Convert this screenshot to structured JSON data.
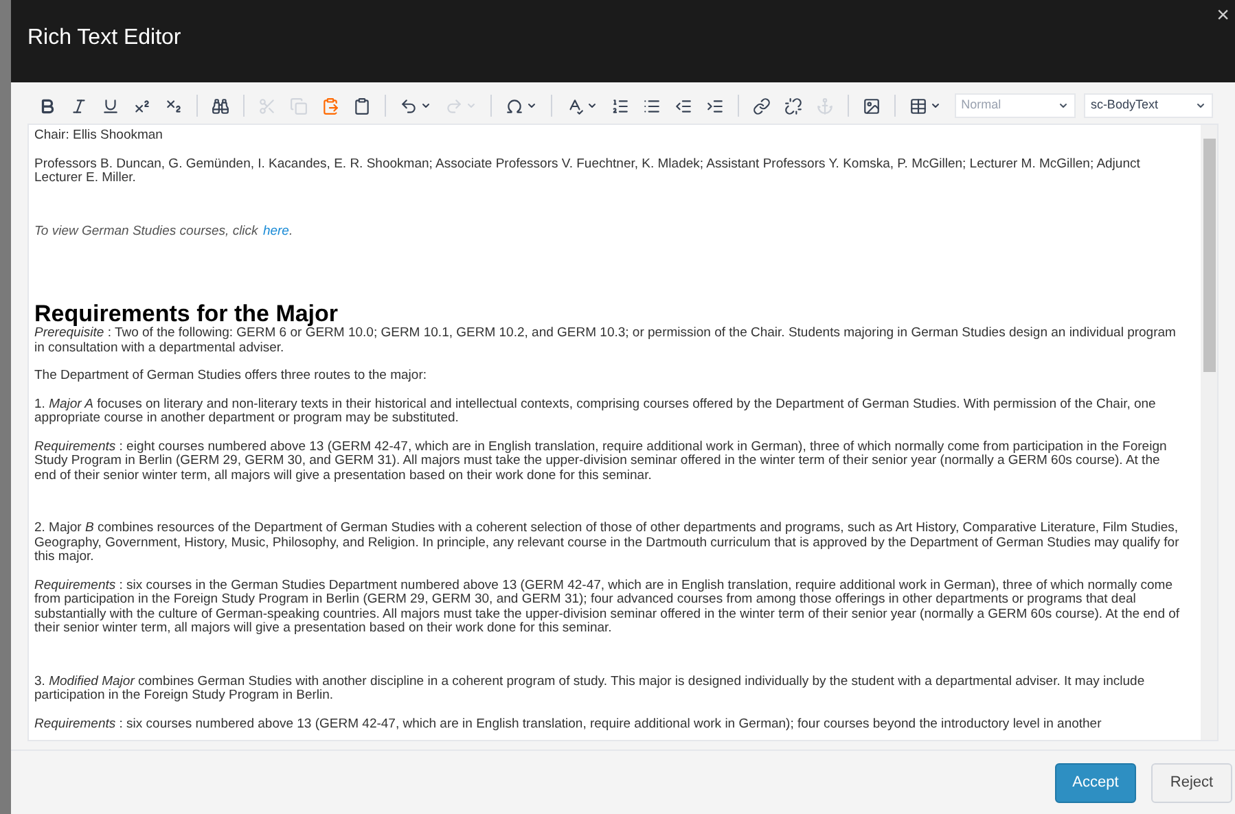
{
  "window": {
    "title": "Rich Text Editor",
    "close": "×"
  },
  "toolbar": [
    {
      "kind": "bold",
      "disabled": false
    },
    {
      "kind": "italic",
      "disabled": false
    },
    {
      "kind": "underline",
      "disabled": false
    },
    {
      "kind": "superscript",
      "disabled": false
    },
    {
      "kind": "subscript",
      "disabled": false
    },
    {
      "kind": "separator"
    },
    {
      "kind": "find",
      "disabled": false
    },
    {
      "kind": "separator"
    },
    {
      "kind": "cut",
      "disabled": true
    },
    {
      "kind": "copy",
      "disabled": true
    },
    {
      "kind": "paste-word",
      "disabled": false
    },
    {
      "kind": "paste",
      "disabled": false
    },
    {
      "kind": "separator"
    },
    {
      "kind": "undo",
      "disabled": false,
      "dropdown": true
    },
    {
      "kind": "redo",
      "disabled": true,
      "dropdown": true
    },
    {
      "kind": "separator"
    },
    {
      "kind": "symbol",
      "disabled": false,
      "dropdown": true
    },
    {
      "kind": "separator"
    },
    {
      "kind": "spellcheck",
      "disabled": false,
      "dropdown": true
    },
    {
      "kind": "ordered-list",
      "disabled": false
    },
    {
      "kind": "bullet-list",
      "disabled": false
    },
    {
      "kind": "outdent",
      "disabled": false
    },
    {
      "kind": "indent",
      "disabled": false
    },
    {
      "kind": "separator"
    },
    {
      "kind": "link",
      "disabled": false
    },
    {
      "kind": "unlink",
      "disabled": false
    },
    {
      "kind": "anchor",
      "disabled": true
    },
    {
      "kind": "separator"
    },
    {
      "kind": "image",
      "disabled": false
    },
    {
      "kind": "separator"
    },
    {
      "kind": "table",
      "disabled": false,
      "dropdown": true
    }
  ],
  "format_selects": [
    {
      "value": "Normal",
      "disabled": true
    },
    {
      "value": "sc-BodyText",
      "disabled": false
    }
  ],
  "content": [
    {
      "kind": "paragraph",
      "text": "Chair: Ellis Shookman"
    },
    {
      "kind": "paragraph",
      "text": "Professors B. Duncan, G. Gemünden, I. Kacandes, E. R. Shookman; Associate Professors V. Fuechtner, K. Mladek; Assistant Professors Y. Komska, P. McGillen; Lecturer M. McGillen; Adjunct Lecturer E. Miller."
    },
    {
      "kind": "blank"
    },
    {
      "kind": "link-paragraph",
      "text": "To view German Studies courses, click ",
      "link": "here",
      "suffix": "."
    },
    {
      "kind": "blank"
    },
    {
      "kind": "blank"
    },
    {
      "kind": "heading",
      "text": "Requirements for the Major"
    },
    {
      "kind": "paragraph",
      "text": "*Prerequisite* : Two of the following: GERM 6 or GERM 10.0; GERM 10.1, GERM 10.2, and GERM 10.3; or permission of the Chair. Students majoring in German Studies design an individual program in consultation with a departmental adviser."
    },
    {
      "kind": "paragraph",
      "text": "The Department of German Studies offers three routes to the major:"
    },
    {
      "kind": "paragraph",
      "text": "1. *Major A* focuses on literary and non-literary texts in their historical and intellectual contexts, comprising courses offered by the Department of German Studies. With permission of the Chair, one appropriate course in another department or program may be substituted."
    },
    {
      "kind": "paragraph",
      "text": "*Requirements* : eight courses numbered above 13 (GERM 42-47, which are in English translation, require additional work in German), three of which normally come from participation in the Foreign Study Program in Berlin (GERM 29, GERM 30, and GERM 31). All majors must take the upper-division seminar offered in the winter term of their senior year (normally a GERM 60s course). At the end of their senior winter term, all majors will give a presentation based on their work done for this seminar."
    },
    {
      "kind": "blank"
    },
    {
      "kind": "paragraph",
      "text": "2. Major *B* combines resources of the Department of German Studies with a coherent selection of those of other departments and programs, such as Art History, Comparative Literature, Film Studies, Geography, Government, History, Music, Philosophy, and Religion. In principle, any relevant course in the Dartmouth curriculum that is approved by the Department of German Studies may qualify for this major."
    },
    {
      "kind": "paragraph",
      "text": "*Requirements* : six courses in the German Studies Department numbered above 13 (GERM 42-47, which are in English translation, require additional work in German), three of which normally come from participation in the Foreign Study Program in Berlin (GERM 29, GERM 30, and GERM 31); four advanced courses from among those offerings in other departments or programs that deal substantially with the culture of German-speaking countries. All majors must take the upper-division seminar offered in the winter term of their senior year (normally a GERM 60s course). At the end of their senior winter term, all majors will give a presentation based on their work done for this seminar."
    },
    {
      "kind": "blank"
    },
    {
      "kind": "paragraph",
      "text": "3. *Modified Major* combines German Studies with another discipline in a coherent program of study. This major is designed individually by the student with a departmental adviser. It may include participation in the Foreign Study Program in Berlin."
    },
    {
      "kind": "paragraph",
      "text": "*Requirements* : six courses numbered above 13 (GERM 42-47, which are in English translation, require additional work in German); four courses beyond the introductory level in another"
    }
  ],
  "buttons": [
    {
      "label": "Accept",
      "kind": "primary"
    },
    {
      "label": "Reject",
      "kind": "secondary"
    }
  ]
}
